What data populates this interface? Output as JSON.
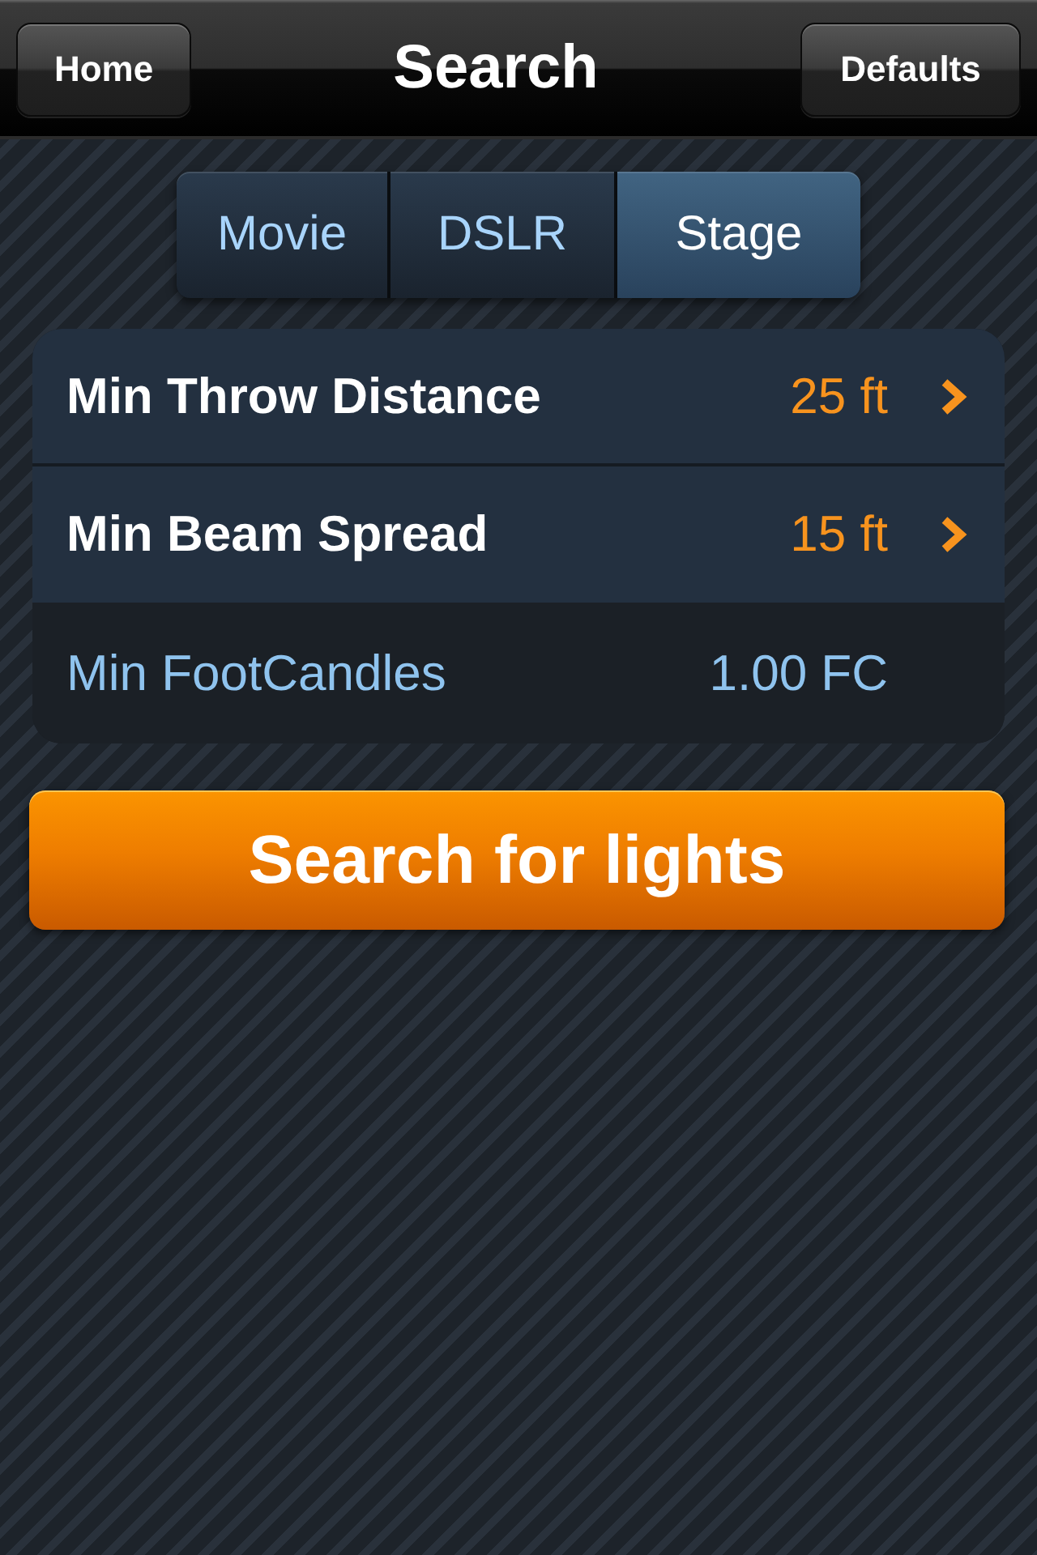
{
  "nav_bar": {
    "title": "Search",
    "left_button": "Home",
    "right_button": "Defaults"
  },
  "tabs": [
    {
      "label": "Movie",
      "selected": false
    },
    {
      "label": "DSLR",
      "selected": false
    },
    {
      "label": "Stage",
      "selected": true
    }
  ],
  "settings": [
    {
      "kind": "disclosure",
      "label": "Min Throw Distance",
      "value": "25 ft"
    },
    {
      "kind": "disclosure",
      "label": "Min Beam Spread",
      "value": "15 ft"
    },
    {
      "kind": "info",
      "label": "Min FootCandles",
      "value": "1.00 FC"
    }
  ],
  "search_button": "Search for lights"
}
